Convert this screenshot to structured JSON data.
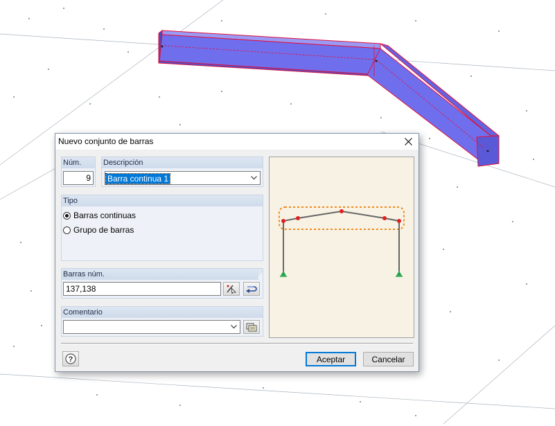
{
  "dialog": {
    "title": "Nuevo conjunto de barras",
    "num_label": "Núm.",
    "num_value": "9",
    "description_label": "Descripción",
    "description_value": "Barra continua 1",
    "type_label": "Tipo",
    "type_options": [
      {
        "label": "Barras continuas",
        "checked": true
      },
      {
        "label": "Grupo de barras",
        "checked": false
      }
    ],
    "members_label": "Barras núm.",
    "members_value": "137,138",
    "comment_label": "Comentario",
    "comment_value": "",
    "ok_label": "Aceptar",
    "cancel_label": "Cancelar"
  },
  "icons": {
    "close": "close-icon",
    "pick": "pick-members-icon",
    "select": "select-in-graphic-icon",
    "comment_library": "comment-library-icon",
    "help": "help-icon"
  },
  "colors": {
    "beam_fill": "#6f6fee",
    "beam_edge": "#e0103c",
    "selection_outline": "#f08a1c",
    "node_red": "#e02020",
    "support_green": "#1fa24a",
    "accent_blue": "#0078d7"
  }
}
